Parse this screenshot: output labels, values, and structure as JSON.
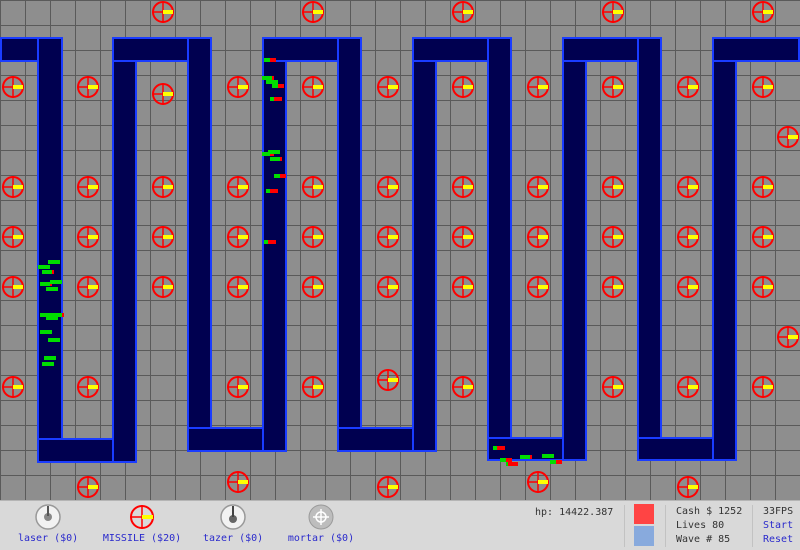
{
  "shop": {
    "laser": {
      "label": "laser ($0)",
      "icon": "laser-turret-icon"
    },
    "missile": {
      "label": "MISSILE ($20)",
      "icon": "missile-turret-icon"
    },
    "tazer": {
      "label": "tazer ($0)",
      "icon": "tazer-turret-icon"
    },
    "mortar": {
      "label": "mortar ($0)",
      "icon": "mortar-turret-icon"
    }
  },
  "status": {
    "hp": "hp: 14422.387",
    "cash": "Cash $ 1252",
    "lives": "Lives 80",
    "wave": "Wave # 85",
    "fps": "33FPS",
    "start": "Start",
    "reset": "Reset"
  },
  "colors": {
    "grid": "#8e8e8e",
    "path": "#000050",
    "path_border": "#1a3cff",
    "tower_ring": "#ff0000",
    "tower_barrel": "#ffff00",
    "creep_health": "#00dd00",
    "creep_damage": "#ff0000",
    "swatch_red": "#ff4444",
    "swatch_blue": "#88aadd"
  }
}
